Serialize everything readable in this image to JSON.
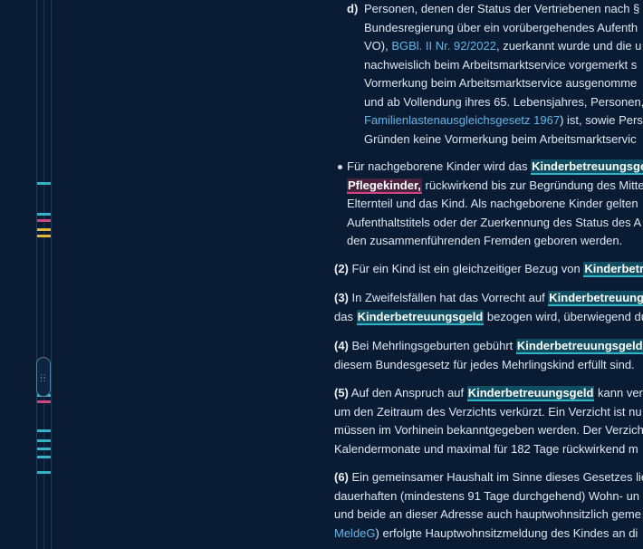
{
  "colors": {
    "background": "#0a1c33",
    "text": "#dce6f0",
    "link": "#5fb6e6",
    "highlight_teal": "#2fb3c7",
    "highlight_pink": "#d0457f",
    "marker_yellow": "#e6b63a"
  },
  "para_d": {
    "label": "d)",
    "l1": "Personen, denen der Status der Vertriebenen nach §",
    "l2": "Bundesregierung über ein vorübergehendes Aufenth",
    "l3_pre": "VO), ",
    "l3_link": "BGBl. II Nr. 92/2022",
    "l3_post": ", zuerkannt wurde und die u",
    "l4": "nachweislich beim Arbeitsmarktservice vorgemerkt s",
    "l5": "Vormerkung beim Arbeitsmarktservice ausgenomme",
    "l6": "und ab Vollendung ihres 65. Lebensjahres, Personen,",
    "l7_link": "Familienlastenausgleichsgesetz 1967",
    "l7_post": ") ist, sowie Pers",
    "l8": "Gründen keine Vormerkung beim Arbeitsmarktservic"
  },
  "bullet": {
    "l1_pre": "Für nachgeborene Kinder wird das ",
    "l1_hl": "Kinderbetreuungsge",
    "l2_hl": "Pflegekinder,",
    "l2_post": " rückwirkend bis zur Begründung des Mitte",
    "l3": "Elternteil und das Kind. Als nachgeborene Kinder gelten",
    "l4": "Aufenthaltstitels oder der Zuerkennung des Status des A",
    "l5": "den zusammenführenden Fremden geboren werden."
  },
  "p2": {
    "num": "(2)",
    "pre": " Für ein Kind ist ein gleichzeitiger Bezug von ",
    "hl": "Kinderbetr"
  },
  "p3": {
    "num": "(3)",
    "l1_pre": " In Zweifelsfällen hat das Vorrecht auf ",
    "l1_hl": "Kinderbetreuung",
    "l2_pre": "das ",
    "l2_hl": "Kinderbetreuungsgeld",
    "l2_post": " bezogen wird, überwiegend du"
  },
  "p4": {
    "num": "(4)",
    "l1_pre": " Bei Mehrlingsgeburten gebührt ",
    "l1_hl": "Kinderbetreuungsgeld",
    "l2": "diesem Bundesgesetz für jedes Mehrlingskind erfüllt sind."
  },
  "p5": {
    "num": "(5)",
    "l1_pre": " Auf den Anspruch auf ",
    "l1_hl": "Kinderbetreuungsgeld",
    "l1_post": " kann verz",
    "l2": "um den Zeitraum des Verzichts verkürzt. Ein Verzicht ist nu",
    "l3": "müssen im Vorhinein bekanntgegeben werden. Der Verzich",
    "l4": "Kalendermonate und maximal für 182 Tage rückwirkend m"
  },
  "p6": {
    "num": "(6)",
    "l1": " Ein gemeinsamer Haushalt im Sinne dieses Gesetzes lie",
    "l2": "dauerhaften (mindestens 91 Tage durchgehend) Wohn- un",
    "l3": "und beide an dieser Adresse auch hauptwohnsitzlich geme",
    "l4_link": "MeldeG",
    "l4_post": ") erfolgte Hauptwohnsitzmeldung des Kindes an di"
  }
}
